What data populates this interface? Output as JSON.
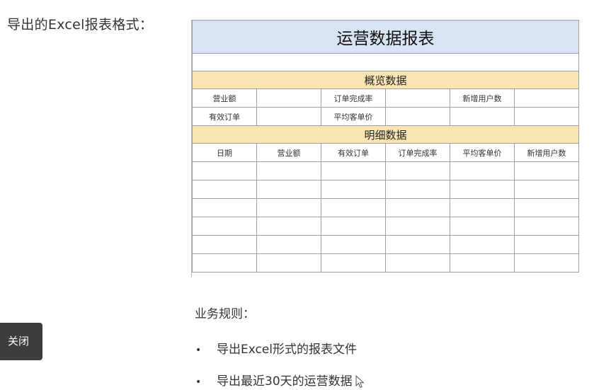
{
  "caption": "导出的Excel报表格式：",
  "report": {
    "title": "运营数据报表",
    "overview_title": "概览数据",
    "overview_rows": [
      {
        "label1": "营业额",
        "label2": "订单完成率",
        "label3": "新增用户数"
      },
      {
        "label1": "有效订单",
        "label2": "平均客单价",
        "label3": ""
      }
    ],
    "detail_title": "明细数据",
    "detail_headers": [
      "日期",
      "营业额",
      "有效订单",
      "订单完成率",
      "平均客单价",
      "新增用户数"
    ],
    "detail_row_count": 6
  },
  "rules": {
    "title": "业务规则：",
    "items": [
      "导出Excel形式的报表文件",
      "导出最近30天的运营数据"
    ]
  },
  "toast": {
    "label": "关闭"
  },
  "colors": {
    "title_bg": "#dae3f3",
    "section_bg": "#fbe6b3",
    "toast_bg": "#3d3d3d"
  }
}
